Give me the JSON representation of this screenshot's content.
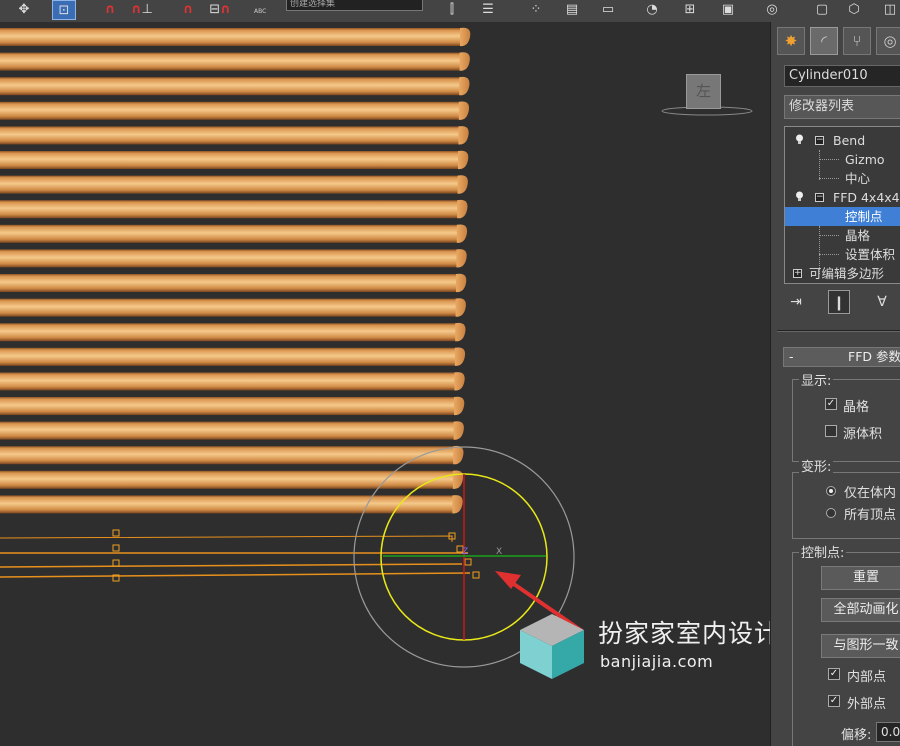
{
  "toolbar": {
    "selection_set_text": "创建选择集",
    "abc_label": "ABC"
  },
  "viewport": {
    "viewcube_label": "左",
    "gizmo_z_label": "Z",
    "gizmo_x_label": "X"
  },
  "watermark": {
    "name": "扮家家室内设计",
    "url": "banjiajia.com"
  },
  "command_panel": {
    "object_name": "Cylinder010",
    "modifier_list": "修改器列表",
    "stack": [
      {
        "label": "Bend"
      },
      {
        "label": "Gizmo"
      },
      {
        "label": "中心"
      },
      {
        "label": "FFD 4x4x4"
      },
      {
        "label": "控制点"
      },
      {
        "label": "晶格"
      },
      {
        "label": "设置体积"
      },
      {
        "label": "可编辑多边形"
      }
    ],
    "ffd_rollout_title": "FFD 参数",
    "display_group": {
      "label": "显示:",
      "lattice": "晶格",
      "lattice_checked": true,
      "source_volume": "源体积",
      "source_volume_checked": false
    },
    "deform_group": {
      "label": "变形:",
      "only_in_volume": "仅在体内",
      "all_vertices": "所有顶点",
      "selected": "only_in_volume"
    },
    "control_points_group": {
      "label": "控制点:",
      "reset": "重置",
      "animate_all": "全部动画化",
      "conform_to_shape": "与图形一致",
      "inside_points": "内部点",
      "inside_checked": true,
      "outside_points": "外部点",
      "outside_checked": true,
      "offset_label": "偏移:",
      "offset_value": "0.0"
    }
  },
  "colors": {
    "wood_light": "#f2c080",
    "wood_mid": "#d9944e",
    "wood_dark": "#8a5326",
    "selection_blue": "#3f7fd6",
    "lattice_orange": "#e8901c",
    "gizmo_yellow": "#e8e818",
    "arrow_red": "#e03030"
  }
}
